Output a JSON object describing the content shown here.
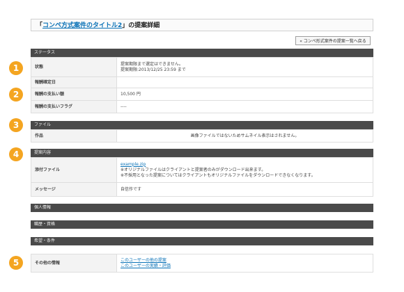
{
  "header": {
    "quote_open": "「",
    "title_link": "コンペ方式案件のタイトル2",
    "title_suffix": "」の提案詳細",
    "back_button": "« コンペ形式案件の提案一覧へ戻る"
  },
  "badges": [
    "1",
    "2",
    "3",
    "4",
    "5"
  ],
  "sections": {
    "status": {
      "header": "ステータス",
      "rows": {
        "state_label": "状態",
        "state_line1": "提案期限まで選定はできません。",
        "state_line2": "提案期限:2013/12/25 23:59 まで",
        "confirm_label": "報酬確定日",
        "confirm_value": "",
        "amount_label": "報酬の支払い額",
        "amount_value": "10,500 円",
        "flag_label": "報酬の支払いフラグ",
        "flag_value": "----"
      }
    },
    "file": {
      "header": "ファイル",
      "rows": {
        "work_label": "作品",
        "work_value": "画像ファイルではないためサムネイル表示はされません。"
      }
    },
    "proposal": {
      "header": "提案内容",
      "rows": {
        "attachment_label": "添付ファイル",
        "attachment_link": "example.zip",
        "attachment_note1": "※オリジナルファイルはクライアントと提案者のみがダウンロード出来ます。",
        "attachment_note2": "※不採用となった提案についてはクライアントもオリジナルファイルをダウンロードできなくなります。",
        "message_label": "メッセージ",
        "message_value": "自信作です"
      }
    },
    "personal": {
      "header": "個人情報"
    },
    "career": {
      "header": "職歴・資格"
    },
    "wishes": {
      "header": "希望・条件",
      "rows": {
        "other_label": "その他の情報",
        "other_link1": "このユーザーの他の提案",
        "other_link2": "このユーザーの実績・評価"
      }
    }
  },
  "colors": {
    "badge": "#f4a521",
    "section_bar": "#4a4a4a",
    "link": "#0a72b7"
  }
}
